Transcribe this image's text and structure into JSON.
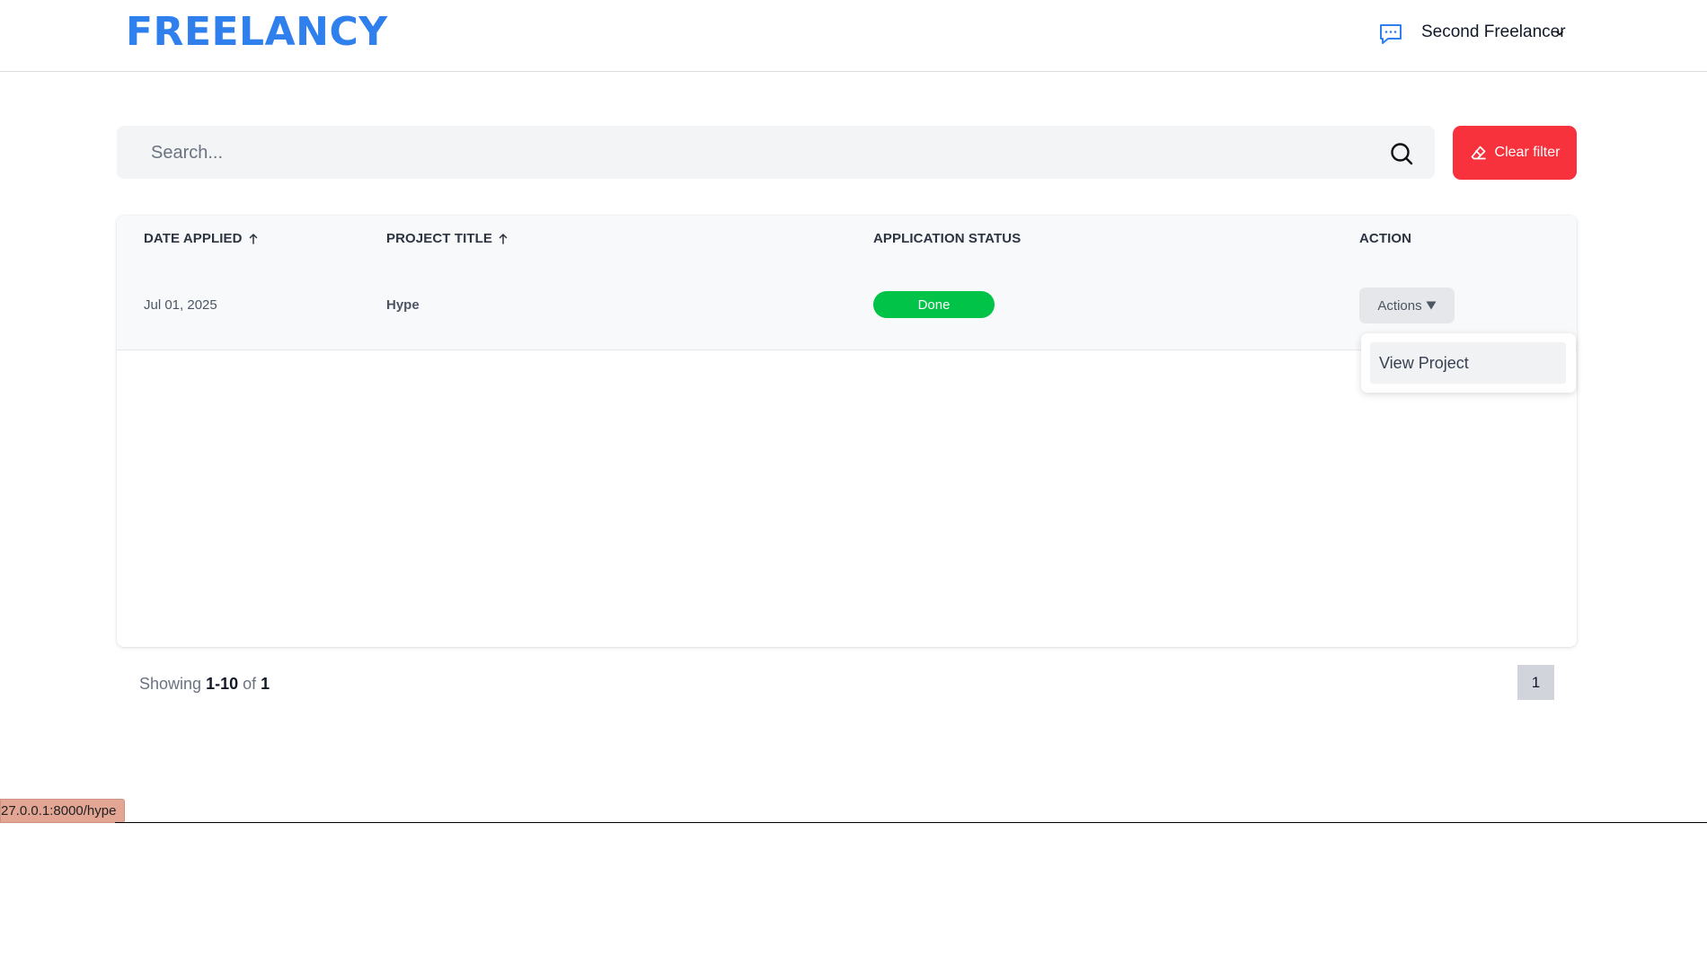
{
  "header": {
    "logo": "FREELANCY",
    "user_name": "Second Freelancer",
    "icons": {
      "chat": "chat-bubble-icon",
      "chevron": "chevron-down-icon"
    },
    "brand_color": "#2f80ed"
  },
  "search": {
    "placeholder": "Search...",
    "value": "",
    "icon": "search-icon"
  },
  "clear_filter": {
    "label": "Clear filter",
    "icon": "eraser-icon",
    "color": "#f7323d"
  },
  "table": {
    "columns": [
      {
        "label": "DATE APPLIED",
        "sortable": true
      },
      {
        "label": "PROJECT TITLE",
        "sortable": true
      },
      {
        "label": "APPLICATION STATUS",
        "sortable": false
      },
      {
        "label": "ACTION",
        "sortable": false
      }
    ],
    "rows": [
      {
        "date_applied": "Jul 01, 2025",
        "project_title": "Hype",
        "status": "Done",
        "status_color": "#00c347",
        "action_label": "Actions"
      }
    ],
    "dropdown": {
      "items": [
        "View Project"
      ]
    }
  },
  "pagination": {
    "showing_prefix": "Showing",
    "range": "1-10",
    "of_label": "of",
    "total": "1",
    "current_page": "1"
  },
  "status_bar": {
    "url": "27.0.0.1:8000/hype"
  }
}
